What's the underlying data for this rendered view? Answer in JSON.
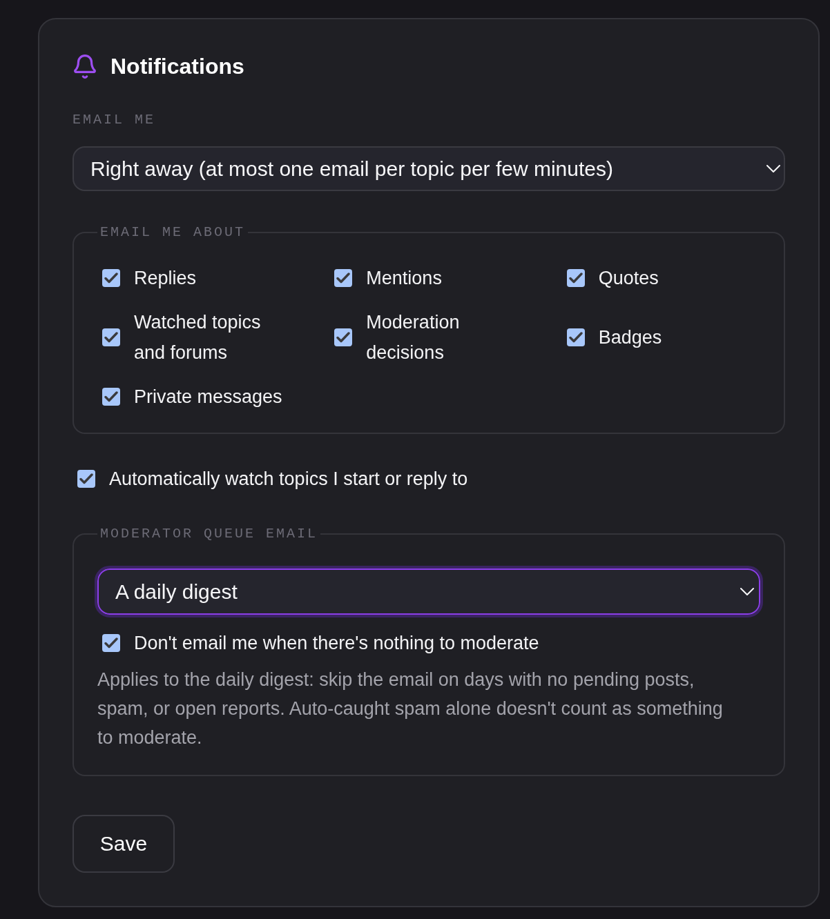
{
  "header": {
    "title": "Notifications"
  },
  "email_me": {
    "label": "EMAIL ME",
    "select": {
      "value": "Right away (at most one email per topic per few minutes)",
      "focused": false
    }
  },
  "email_me_about": {
    "legend": "EMAIL ME ABOUT",
    "options": [
      {
        "label": "Replies",
        "checked": true
      },
      {
        "label": "Mentions",
        "checked": true
      },
      {
        "label": "Quotes",
        "checked": true
      },
      {
        "label": "Watched topics and forums",
        "checked": true
      },
      {
        "label": "Moderation decisions",
        "checked": true
      },
      {
        "label": "Badges",
        "checked": true
      },
      {
        "label": "Private messages",
        "checked": true
      }
    ]
  },
  "auto_watch": {
    "label": "Automatically watch topics I start or reply to",
    "checked": true
  },
  "moderator_queue_email": {
    "legend": "MODERATOR QUEUE EMAIL",
    "select": {
      "value": "A daily digest",
      "focused": true
    },
    "skip_when_empty": {
      "label": "Don't email me when there's nothing to moderate",
      "checked": true
    },
    "help": "Applies to the daily digest: skip the email on days with no pending posts, spam, or open reports. Auto-caught spam alone doesn't count as something to moderate."
  },
  "save_button": {
    "label": "Save"
  }
}
